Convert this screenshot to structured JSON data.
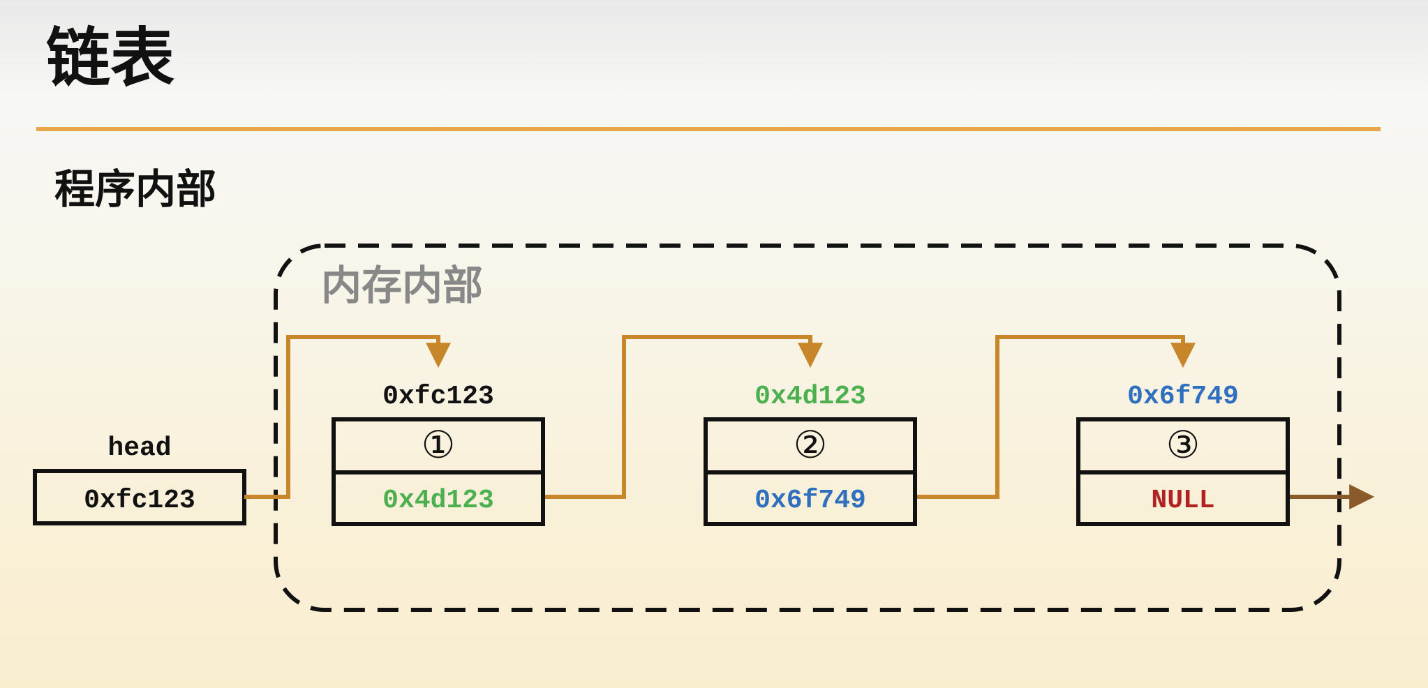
{
  "title": "链表",
  "section_label": "程序内部",
  "memory_label": "内存内部",
  "head": {
    "label": "head",
    "value": "0xfc123"
  },
  "nodes": [
    {
      "address": "0xfc123",
      "address_color": "#111111",
      "number": "①",
      "next": "0x4d123",
      "next_color": "#4caf50"
    },
    {
      "address": "0x4d123",
      "address_color": "#4caf50",
      "number": "②",
      "next": "0x6f749",
      "next_color": "#2f6fc0"
    },
    {
      "address": "0x6f749",
      "address_color": "#2f6fc0",
      "number": "③",
      "next": "NULL",
      "next_color": "#b22222"
    }
  ],
  "colors": {
    "accent_rule": "#e8a54a",
    "pointer_arrow": "#c8862a",
    "null_arrow": "#8a5a2b",
    "box_stroke": "#111111",
    "dashed_border": "#111111"
  },
  "icons": {
    "pointer": "arrow-right",
    "memory_region": "dashed-rounded-rectangle"
  }
}
